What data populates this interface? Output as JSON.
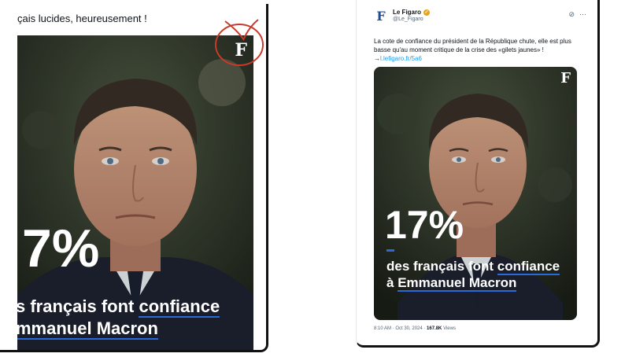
{
  "left": {
    "caption": "çais lucides, heureusement !",
    "stat": "7%",
    "line1_pre": "s français font ",
    "line1_em": "confiance",
    "line2": "mmanuel Macron",
    "logo": "F"
  },
  "tweet": {
    "author_name": "Le Figaro",
    "author_handle": "@Le_Figaro",
    "logo": "F",
    "text": "La cote de confiance du président de la République chute, elle est plus basse qu'au moment critique de la crise des «gilets jaunes» !",
    "link_prefix": "→",
    "link": "l.lefigaro.fr/5a6",
    "stat": "17%",
    "line1_pre": "des français font ",
    "line1_em": "confiance",
    "line2_pre": "à ",
    "line2_em": "Emmanuel Macron",
    "time": "8:10 AM · Oct 30, 2024 · ",
    "views_count": "167.8K",
    "views_label": " Views",
    "colors": {
      "accent_underline": "#2a6ad8",
      "annotation_circle": "#c83a2a",
      "link": "#1d9bf0"
    }
  }
}
